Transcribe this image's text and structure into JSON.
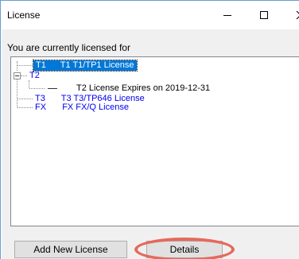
{
  "window": {
    "title": "License",
    "controls": {
      "minimize": "minimize",
      "maximize": "maximize",
      "close": "close"
    }
  },
  "prompt": "You are currently licensed for",
  "tree": {
    "items": [
      {
        "code": "T1",
        "label": "T1 T1/TP1 License",
        "selected": true
      },
      {
        "code": "T2",
        "label": "",
        "children": [
          {
            "code": "",
            "label": "T2 License  Expires on 2019-12-31"
          }
        ]
      },
      {
        "code": "T3",
        "label": "T3 T3/TP646 License"
      },
      {
        "code": "FX",
        "label": "FX FX/Q License"
      }
    ]
  },
  "buttons": {
    "add_new_license": "Add New License",
    "details": "Details"
  },
  "colors": {
    "link_blue": "#0000ee",
    "selection": "#0078d7",
    "highlight_ring": "#e46a5c"
  }
}
